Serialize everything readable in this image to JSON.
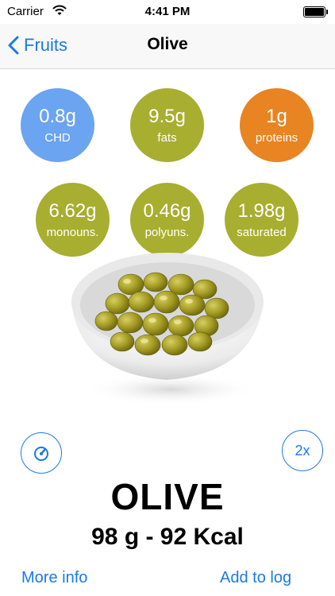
{
  "status_bar": {
    "carrier": "Carrier",
    "time": "4:41 PM"
  },
  "nav": {
    "back_label": "Fruits",
    "title": "Olive"
  },
  "nutrients": [
    {
      "value": "0.8g",
      "label": "CHD",
      "color": "#6ba4f0"
    },
    {
      "value": "9.5g",
      "label": "fats",
      "color": "#a8ae2f"
    },
    {
      "value": "1g",
      "label": "proteins",
      "color": "#e88422"
    },
    {
      "value": "6.62g",
      "label": "monouns.",
      "color": "#a8ae2f"
    },
    {
      "value": "0.46g",
      "label": "polyuns.",
      "color": "#a8ae2f"
    },
    {
      "value": "1.98g",
      "label": "saturated",
      "color": "#a8ae2f"
    }
  ],
  "controls": {
    "portion_label": "2x",
    "timer_icon": "timer-icon"
  },
  "food": {
    "name": "OLIVE",
    "summary": "98 g - 92 Kcal"
  },
  "links": {
    "more_info": "More info",
    "add_to_log": "Add to log"
  },
  "colors": {
    "accent": "#1a7ae6",
    "olive": "#a8ae2f",
    "carbs": "#6ba4f0",
    "protein": "#e88422"
  }
}
